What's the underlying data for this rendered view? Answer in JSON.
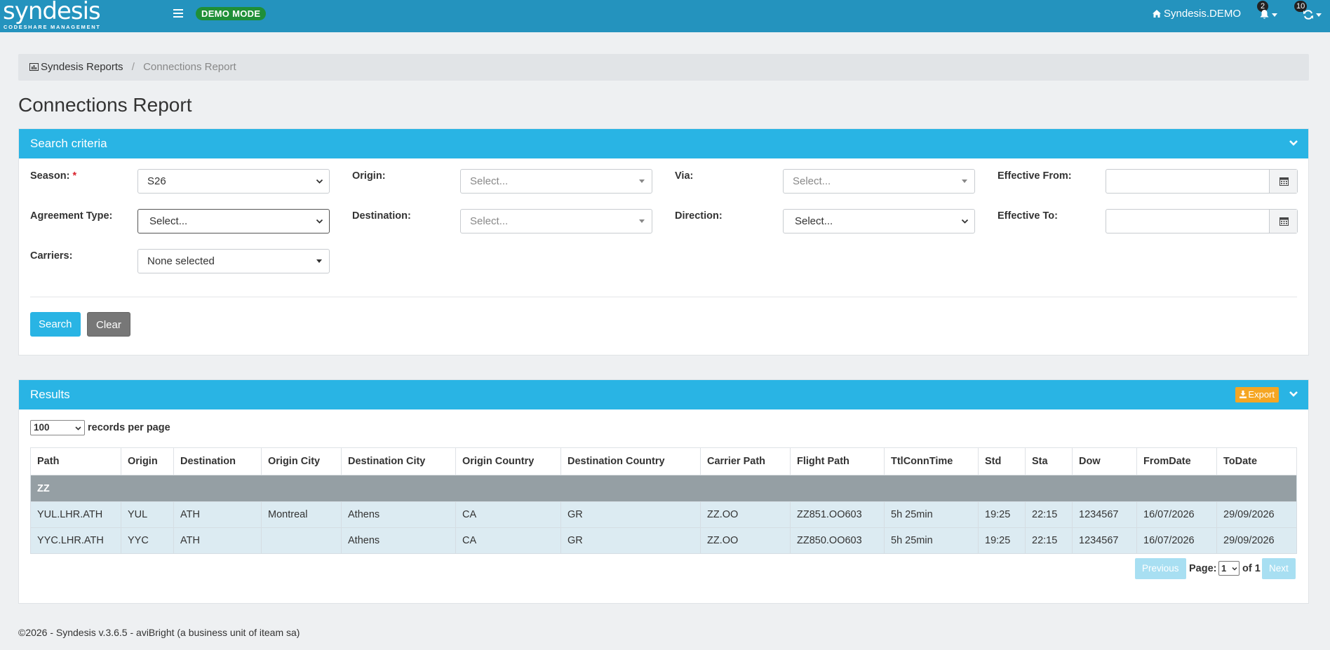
{
  "app": {
    "logo_main": "syndesis",
    "logo_sub": "CODESHARE MANAGEMENT",
    "demo_badge": "DEMO MODE",
    "user_label": "Syndesis.DEMO",
    "notifications_count": "2",
    "sync_count": "10"
  },
  "breadcrumb": {
    "root": "Syndesis Reports",
    "current": "Connections Report"
  },
  "page_title": "Connections Report",
  "search": {
    "title": "Search criteria",
    "season_label": "Season:",
    "season_required": "*",
    "season_value": "S26",
    "origin_label": "Origin:",
    "origin_placeholder": "Select...",
    "via_label": "Via:",
    "via_placeholder": "Select...",
    "effective_from_label": "Effective From:",
    "effective_from_value": "",
    "agreement_type_label": "Agreement Type:",
    "agreement_type_value": "Select...",
    "destination_label": "Destination:",
    "destination_placeholder": "Select...",
    "direction_label": "Direction:",
    "direction_value": "Select...",
    "effective_to_label": "Effective To:",
    "effective_to_value": "",
    "carriers_label": "Carriers:",
    "carriers_value": "None selected",
    "search_button": "Search",
    "clear_button": "Clear"
  },
  "results": {
    "title": "Results",
    "export_label": "Export",
    "per_page_value": "100",
    "per_page_label": "records per page",
    "columns": [
      "Path",
      "Origin",
      "Destination",
      "Origin City",
      "Destination City",
      "Origin Country",
      "Destination Country",
      "Carrier Path",
      "Flight Path",
      "TtlConnTime",
      "Std",
      "Sta",
      "Dow",
      "FromDate",
      "ToDate"
    ],
    "group_label": "ZZ",
    "rows": [
      [
        "YUL.LHR.ATH",
        "YUL",
        "ATH",
        "Montreal",
        "Athens",
        "CA",
        "GR",
        "ZZ.OO",
        "ZZ851.OO603",
        "5h 25min",
        "19:25",
        "22:15",
        "1234567",
        "16/07/2026",
        "29/09/2026"
      ],
      [
        "YYC.LHR.ATH",
        "YYC",
        "ATH",
        "",
        "Athens",
        "CA",
        "GR",
        "ZZ.OO",
        "ZZ850.OO603",
        "5h 25min",
        "19:25",
        "22:15",
        "1234567",
        "16/07/2026",
        "29/09/2026"
      ]
    ],
    "pagination": {
      "previous": "Previous",
      "page_label": "Page:",
      "page_value": "1",
      "of_label": "of 1",
      "next": "Next"
    }
  },
  "footer": "©2026 - Syndesis v.3.6.5 - aviBright (a business unit of iteam sa)",
  "colors": {
    "topbar": "#2493be",
    "panel_header": "#29b4e4",
    "demo_badge": "#1f8f37",
    "export": "#f5a623",
    "row_bg": "#dcebf2",
    "group_bg": "#959fa4"
  },
  "icons": [
    "menu-icon",
    "home-icon",
    "bell-icon",
    "sync-icon",
    "chart-icon",
    "chevron-down-icon",
    "calendar-icon",
    "download-icon"
  ]
}
